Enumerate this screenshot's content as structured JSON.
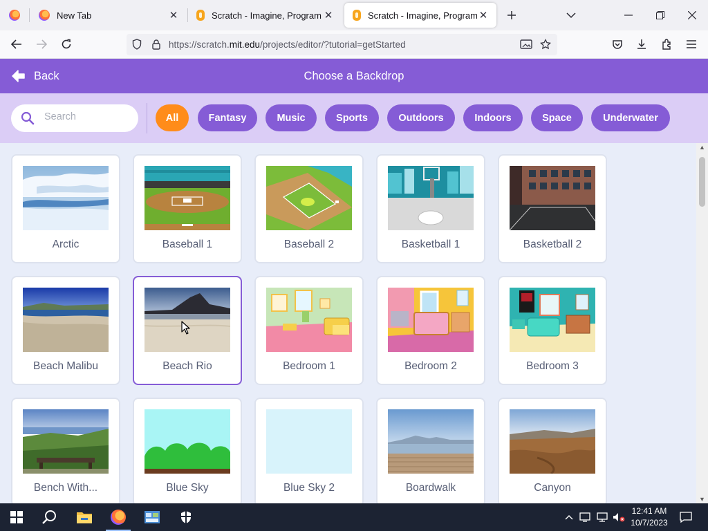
{
  "browser": {
    "tabs": [
      {
        "title": "New Tab",
        "close": "✕"
      },
      {
        "title": "Scratch - Imagine, Program, Share",
        "close": "✕"
      },
      {
        "title": "Scratch - Imagine, Program, Share",
        "close": "✕"
      }
    ],
    "url_prefix": "https://scratch.",
    "url_domain": "mit.edu",
    "url_path": "/projects/editor/?tutorial=getStarted"
  },
  "header": {
    "back_label": "Back",
    "title": "Choose a Backdrop"
  },
  "filter": {
    "search_placeholder": "Search",
    "tags": [
      "All",
      "Fantasy",
      "Music",
      "Sports",
      "Outdoors",
      "Indoors",
      "Space",
      "Underwater"
    ],
    "selected": "All"
  },
  "backdrops": [
    {
      "name": "Arctic"
    },
    {
      "name": "Baseball 1"
    },
    {
      "name": "Baseball 2"
    },
    {
      "name": "Basketball 1"
    },
    {
      "name": "Basketball 2"
    },
    {
      "name": "Beach Malibu"
    },
    {
      "name": "Beach Rio"
    },
    {
      "name": "Bedroom 1"
    },
    {
      "name": "Bedroom 2"
    },
    {
      "name": "Bedroom 3"
    },
    {
      "name": "Bench With..."
    },
    {
      "name": "Blue Sky"
    },
    {
      "name": "Blue Sky 2"
    },
    {
      "name": "Boardwalk"
    },
    {
      "name": "Canyon"
    }
  ],
  "taskbar": {
    "time": "12:41 AM",
    "date": "10/7/2023"
  },
  "colors": {
    "header_purple": "#855cd6",
    "filter_bg": "#dbcdf6",
    "selected_orange": "#ff8c1a",
    "library_bg": "#e8edf9"
  }
}
